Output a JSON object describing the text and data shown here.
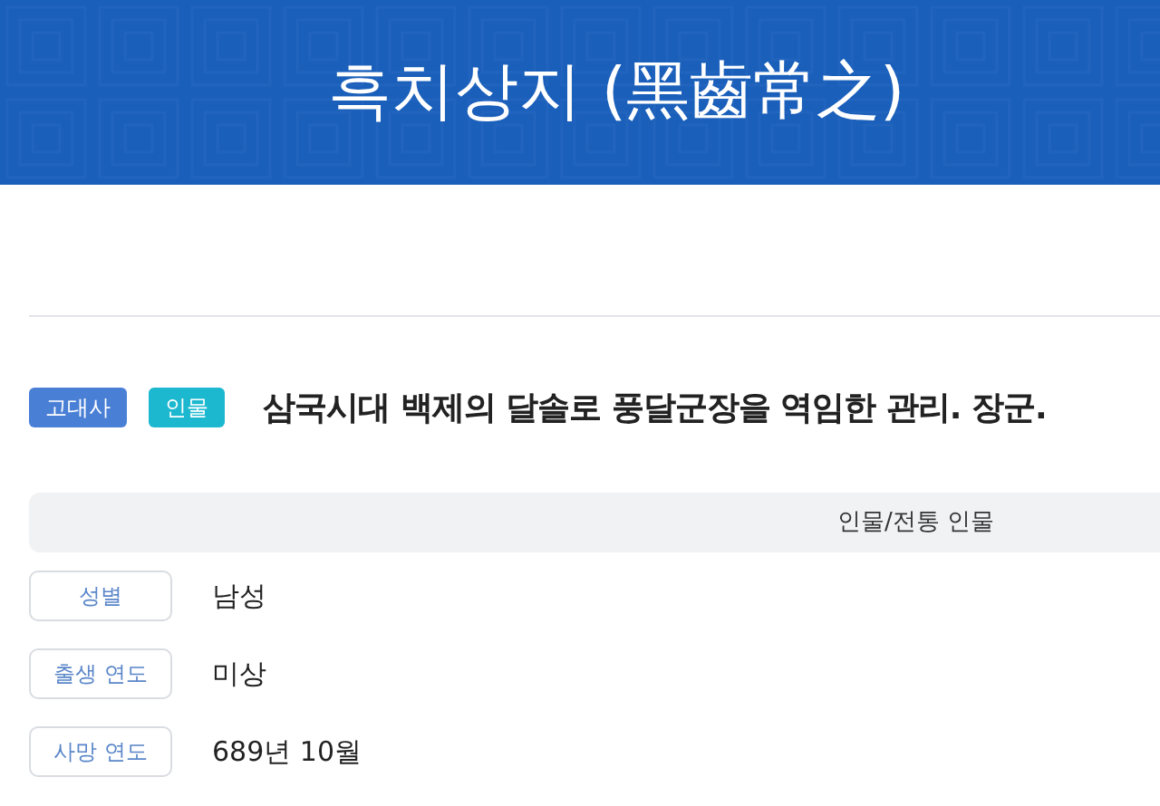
{
  "title": "흑치상지 (黑齒常之)",
  "tags": [
    {
      "label": "고대사",
      "color": "#4a7fd6"
    },
    {
      "label": "인물",
      "color": "#1bb8d0"
    }
  ],
  "summary": "삼국시대 백제의 달솔로 풍달군장을 역임한 관리. 장군.",
  "category": "인물/전통 인물",
  "facts": [
    {
      "label": "성별",
      "value": "남성"
    },
    {
      "label": "출생 연도",
      "value": "미상"
    },
    {
      "label": "사망 연도",
      "value": "689년 10월"
    }
  ]
}
